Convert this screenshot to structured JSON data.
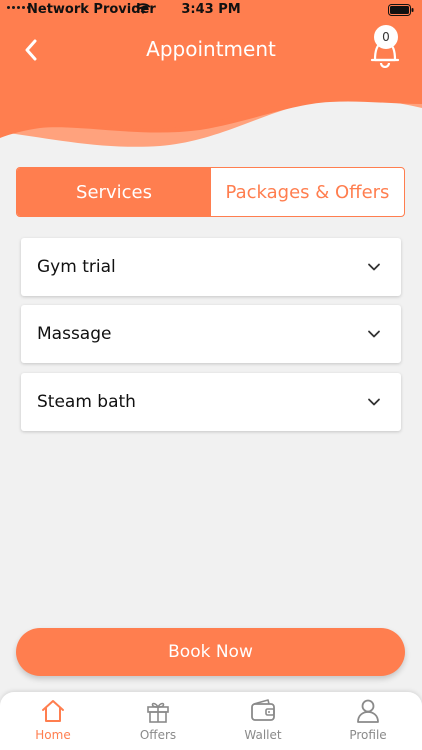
{
  "status_bar": {
    "carrier": "Network Provider",
    "time": "3:43 PM"
  },
  "header": {
    "title": "Appointment",
    "notification_count": "0"
  },
  "tabs": [
    {
      "label": "Services",
      "active": true
    },
    {
      "label": "Packages & Offers",
      "active": false
    }
  ],
  "services": [
    {
      "label": "Gym trial"
    },
    {
      "label": "Massage"
    },
    {
      "label": "Steam bath"
    }
  ],
  "book_button": {
    "label": "Book Now"
  },
  "bottom_nav": [
    {
      "label": "Home",
      "icon": "home-icon",
      "active": true
    },
    {
      "label": "Offers",
      "icon": "gift-icon",
      "active": false
    },
    {
      "label": "Wallet",
      "icon": "wallet-icon",
      "active": false
    },
    {
      "label": "Profile",
      "icon": "user-icon",
      "active": false
    }
  ],
  "colors": {
    "accent": "#ff7e4f",
    "accent_light": "#ffa27d",
    "background": "#f1f1f1"
  }
}
